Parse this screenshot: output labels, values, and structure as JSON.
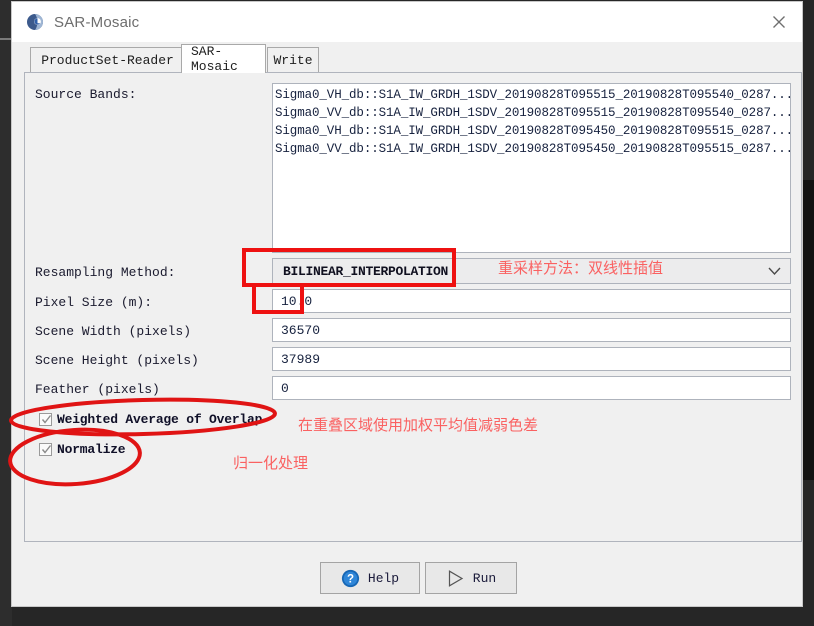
{
  "window": {
    "title": "SAR-Mosaic",
    "app_icon": "globe-icon",
    "close_icon": "close-icon"
  },
  "tabs": [
    {
      "label": "ProductSet-Reader",
      "active": false
    },
    {
      "label": "SAR-Mosaic",
      "active": true
    },
    {
      "label": "Write",
      "active": false
    }
  ],
  "form": {
    "source_bands": {
      "label": "Source Bands:",
      "items": [
        "Sigma0_VH_db::S1A_IW_GRDH_1SDV_20190828T095515_20190828T095540_0287...",
        "Sigma0_VV_db::S1A_IW_GRDH_1SDV_20190828T095515_20190828T095540_0287...",
        "Sigma0_VH_db::S1A_IW_GRDH_1SDV_20190828T095450_20190828T095515_0287...",
        "Sigma0_VV_db::S1A_IW_GRDH_1SDV_20190828T095450_20190828T095515_0287..."
      ]
    },
    "resampling_method": {
      "label": "Resampling Method:",
      "value": "BILINEAR_INTERPOLATION",
      "arrow_icon": "chevron-down-icon"
    },
    "pixel_size": {
      "label": "Pixel Size (m):",
      "value": "10.0"
    },
    "scene_width": {
      "label": "Scene Width (pixels)",
      "value": "36570"
    },
    "scene_height": {
      "label": "Scene Height (pixels)",
      "value": "37989"
    },
    "feather": {
      "label": "Feather (pixels)",
      "value": "0"
    },
    "weighted_average": {
      "label": "Weighted Average of Overlap",
      "checked": true
    },
    "normalize": {
      "label": "Normalize",
      "checked": true
    }
  },
  "buttons": {
    "help": {
      "label": "Help",
      "icon": "question-circle-icon"
    },
    "run": {
      "label": "Run",
      "icon": "play-triangle-icon"
    }
  },
  "annotations": {
    "color": "#fa6161",
    "resampling_note": "重采样方法：双线性插值",
    "overlap_note": "在重叠区域使用加权平均值减弱色差",
    "normalize_note": "归一化处理"
  }
}
